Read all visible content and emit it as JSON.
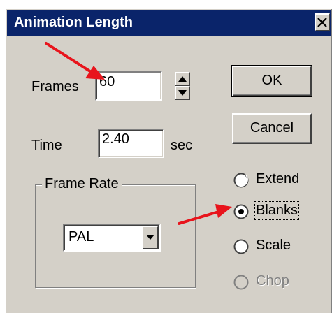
{
  "window": {
    "title": "Animation Length"
  },
  "fields": {
    "frames_label": "Frames",
    "frames_value": "60",
    "time_label": "Time",
    "time_value": "2.40",
    "time_unit": "sec"
  },
  "buttons": {
    "ok": "OK",
    "cancel": "Cancel"
  },
  "frame_rate": {
    "group_title": "Frame Rate",
    "selected": "PAL"
  },
  "options": [
    {
      "label": "Extend",
      "checked": false,
      "enabled": true
    },
    {
      "label": "Blanks",
      "checked": true,
      "enabled": true
    },
    {
      "label": "Scale",
      "checked": false,
      "enabled": true
    },
    {
      "label": "Chop",
      "checked": false,
      "enabled": false
    }
  ],
  "colors": {
    "titlebar": "#0a246a",
    "dialog_face": "#d4d0c8",
    "annotation_arrow": "#e8141c"
  },
  "icons": [
    "close-icon",
    "spin-up-icon",
    "spin-down-icon",
    "dropdown-arrow-icon"
  ]
}
